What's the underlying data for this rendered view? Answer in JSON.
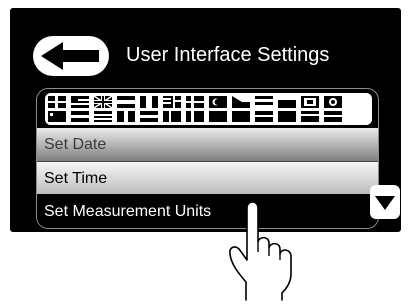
{
  "header": {
    "title": "User Interface Settings",
    "back_icon": "back-arrow-icon"
  },
  "language_bar": {
    "icon": "language-flags-icon"
  },
  "menu": {
    "items": [
      {
        "label": "Set Date"
      },
      {
        "label": "Set Time"
      },
      {
        "label": "Set Measurement Units"
      }
    ]
  },
  "scroll": {
    "down_icon": "scroll-down-icon"
  },
  "hand_icon": "pointing-hand-icon",
  "colors": {
    "screen": "#000000",
    "panel_border": "#8c8c8c",
    "highlight_light": "#f6f6f6",
    "highlight_dark": "#7e7e7e"
  }
}
